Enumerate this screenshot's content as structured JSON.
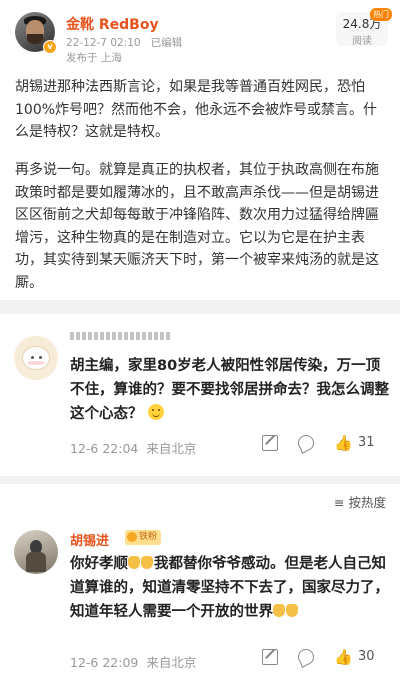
{
  "post": {
    "author": "金靴 RedBoy",
    "verified_badge": "v",
    "timestamp": "22-12-7 02:10",
    "edited": "已编辑",
    "location": "发布于 上海",
    "reads": "24.8万",
    "reads_label": "阅读",
    "hot_badge": "热门",
    "paragraph1": "胡锡进那种法西斯言论，如果是我等普通百姓网民，恐怕100%炸号吧？然而他不会，他永远不会被炸号或禁言。什么是特权？这就是特权。",
    "paragraph2": "再多说一句。就算是真正的执权者，其位于执政高侧在布施政策时都是要如履薄冰的，且不敢高声杀伐——但是胡锡进区区衙前之犬却每每敢于冲锋陷阵、数次用力过猛得给牌匾增污，这种生物真的是在制造对立。它以为它是在护主表功，其实待到某天赈济天下时，第一个被宰来炖汤的就是这厮。"
  },
  "comment1": {
    "text": "胡主编，家里80岁老人被阳性邻居传染，万一顶不住，算谁的？要不要找邻居拼命去？我怎么调整这个心态？",
    "time": "12-6 22:04",
    "source": "来自北京",
    "likes": "31"
  },
  "sort": {
    "label": "按热度"
  },
  "comment2": {
    "author": "胡锡进",
    "fan_badge": "铁粉",
    "text_a": "你好孝顺",
    "text_b": "我都替你爷爷感动。但是老人自己知道算谁的，知道清零坚持不下去了，国家尽力了，知道年轻人需要一个开放的世界",
    "time": "12-6 22:09",
    "source": "来自北京",
    "likes": "30"
  },
  "icons": {
    "edit": "edit-icon",
    "comment": "comment-icon",
    "like": "thumbs-up-icon",
    "sort": "sort-icon"
  },
  "colors": {
    "username": "#e8541e",
    "verified": "#f7a518",
    "hot": "#ff8200"
  }
}
